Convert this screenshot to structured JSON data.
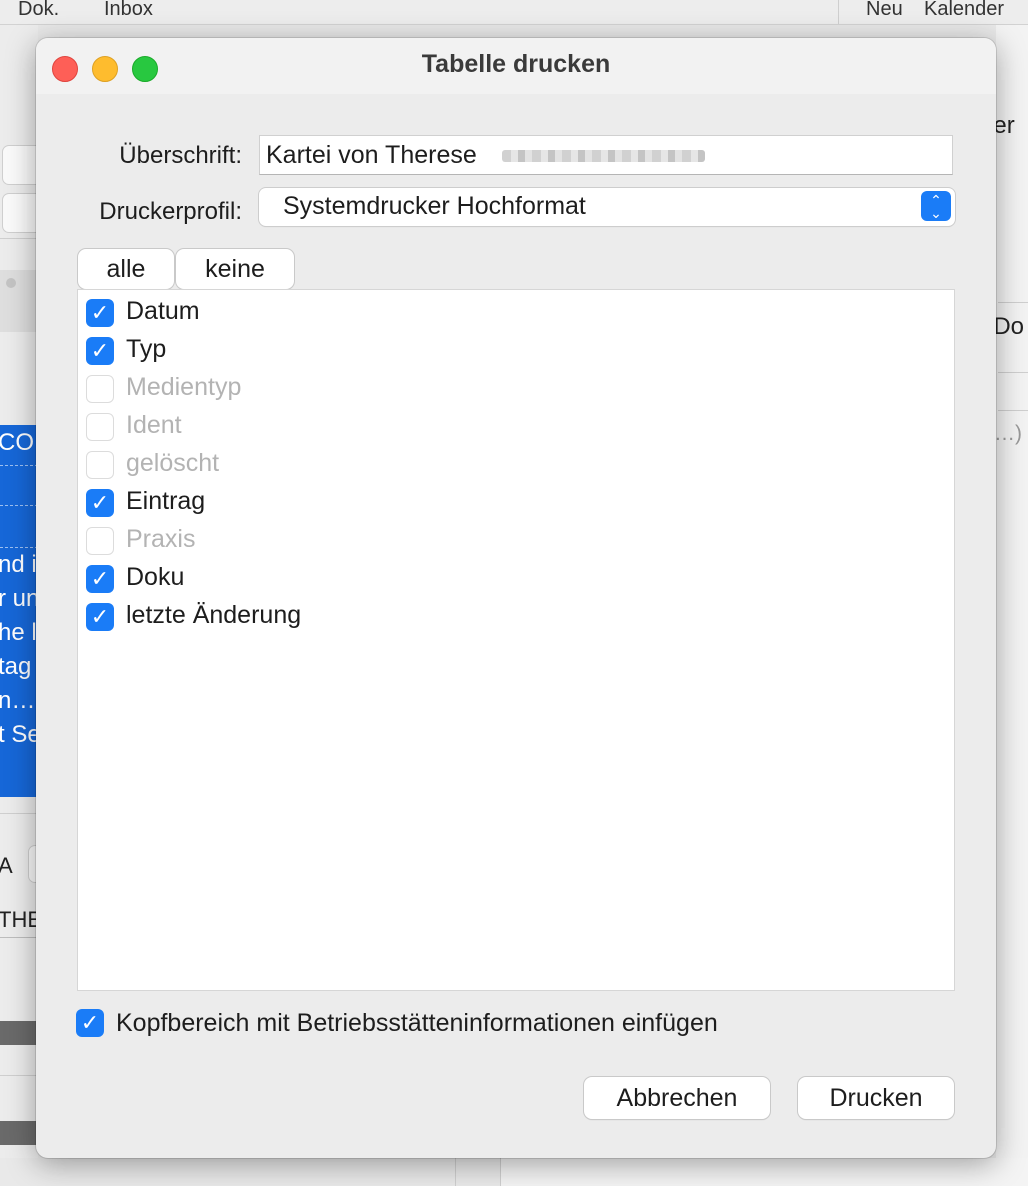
{
  "background_app": {
    "menu_left": [
      "Dok.",
      "Inbox"
    ],
    "menu_right": [
      "Neu",
      "Kalender"
    ],
    "left_fragments": [
      "CO",
      "nd in",
      "r un",
      "he l",
      "tag",
      "n…",
      "t Se",
      "A",
      "THE"
    ],
    "right_fragments": [
      "der",
      "eDo",
      "…)"
    ]
  },
  "dialog": {
    "title": "Tabelle drucken",
    "heading_label": "Überschrift:",
    "heading_value": "Kartei von Therese",
    "profile_label": "Druckerprofil:",
    "profile_value": "Systemdrucker Hochformat",
    "select_all_label": "alle",
    "select_none_label": "keine",
    "columns": [
      {
        "label": "Datum",
        "checked": true,
        "enabled": true
      },
      {
        "label": "Typ",
        "checked": true,
        "enabled": true
      },
      {
        "label": "Medientyp",
        "checked": false,
        "enabled": false
      },
      {
        "label": "Ident",
        "checked": false,
        "enabled": false
      },
      {
        "label": "gelöscht",
        "checked": false,
        "enabled": false
      },
      {
        "label": "Eintrag",
        "checked": true,
        "enabled": true
      },
      {
        "label": "Praxis",
        "checked": false,
        "enabled": false
      },
      {
        "label": "Doku",
        "checked": true,
        "enabled": true
      },
      {
        "label": "letzte Änderung",
        "checked": true,
        "enabled": true
      }
    ],
    "header_option_label": "Kopfbereich mit Betriebsstätteninformationen einfügen",
    "header_option_checked": true,
    "cancel_label": "Abbrechen",
    "print_label": "Drucken"
  },
  "icons": {
    "checkmark": "✓",
    "select_up": "⌃",
    "select_down": "⌄"
  },
  "colors": {
    "accent": "#1a7cf7",
    "close": "#fe5f57",
    "minimize": "#febc2e",
    "maximize": "#28c840",
    "background_selection": "#1667d8"
  }
}
